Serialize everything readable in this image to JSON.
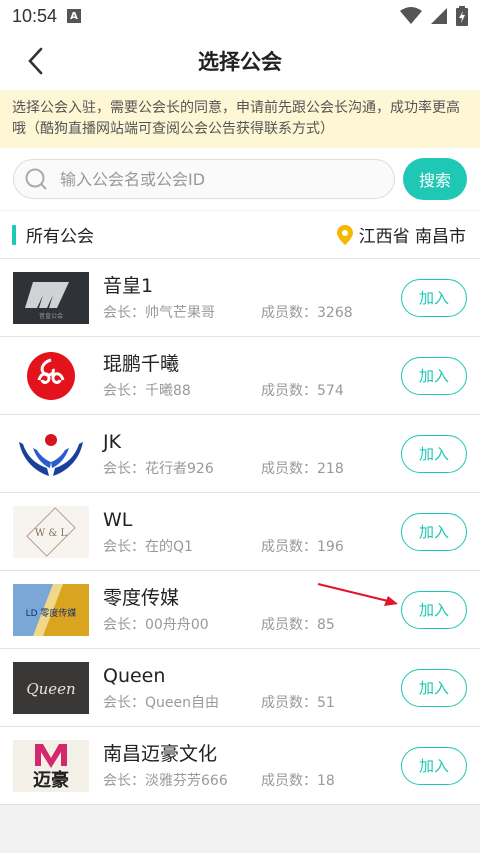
{
  "status_bar": {
    "time": "10:54",
    "notification_icon": "A"
  },
  "header": {
    "title": "选择公会",
    "back_icon": "chevron-left-icon"
  },
  "notice": {
    "text": "选择公会入驻，需要公会长的同意，申请前先跟公会长沟通，成功率更高哦（酷狗直播网站端可查阅公会公告获得联系方式）"
  },
  "search": {
    "placeholder": "输入公会名或公会ID",
    "button_label": "搜索"
  },
  "section": {
    "title": "所有公会",
    "location": "江西省 南昌市"
  },
  "colors": {
    "accent": "#1ec8b4",
    "notice_bg": "#fdf7d5",
    "annotation": "#e0142b"
  },
  "guilds": [
    {
      "name": "音皇1",
      "leader": "会长：帅气芒果哥",
      "members": "成员数：3268",
      "join_label": "加入",
      "logo_text": "音皇公会"
    },
    {
      "name": "琨鹏千曦",
      "leader": "会长：千曦88",
      "members": "成员数：574",
      "join_label": "加入"
    },
    {
      "name": "JK",
      "leader": "会长：花行者926",
      "members": "成员数：218",
      "join_label": "加入"
    },
    {
      "name": "WL",
      "leader": "会长：在的Q1",
      "members": "成员数：196",
      "join_label": "加入",
      "logo_text": "W & L"
    },
    {
      "name": "零度传媒",
      "leader": "会长：00舟舟00",
      "members": "成员数：85",
      "join_label": "加入",
      "logo_text": "LD 零度传媒"
    },
    {
      "name": "Queen",
      "leader": "会长：Queen自由",
      "members": "成员数：51",
      "join_label": "加入",
      "logo_text": "Queen"
    },
    {
      "name": "南昌迈豪文化",
      "leader": "会长：淡雅芬芳666",
      "members": "成员数：18",
      "join_label": "加入",
      "logo_text": "迈豪"
    }
  ]
}
